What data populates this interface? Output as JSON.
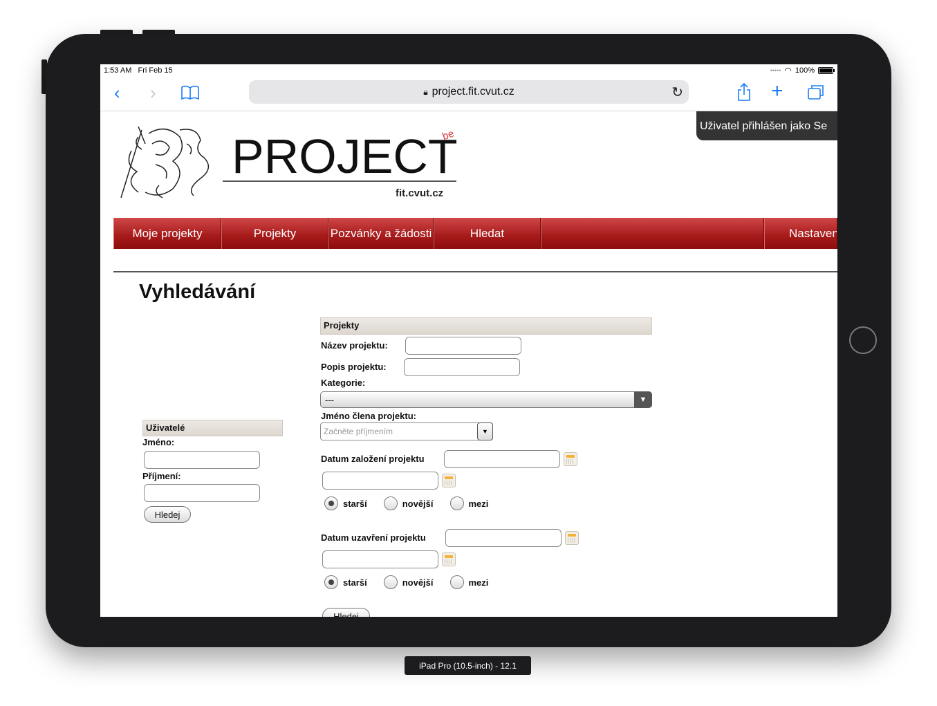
{
  "status_bar": {
    "time": "1:53 AM",
    "date": "Fri Feb 15",
    "battery": "100%",
    "battery_level": 1.0
  },
  "browser": {
    "url": "project.fit.cvut.cz"
  },
  "header": {
    "logo_word": "PROJECT",
    "logo_sub": "fit.cvut.cz",
    "logo_mark": "be",
    "user_status": "Uživatel přihlášen jako Se"
  },
  "nav": {
    "items": [
      "Moje projekty",
      "Projekty",
      "Pozvánky a žádosti",
      "Hledat",
      "",
      "Nastaven"
    ]
  },
  "page": {
    "title": "Vyhledávání"
  },
  "users": {
    "heading": "Uživatelé",
    "first_name_label": "Jméno:",
    "last_name_label": "Příjmení:",
    "search_button": "Hledej"
  },
  "projects": {
    "heading": "Projekty",
    "name_label": "Název projektu:",
    "description_label": "Popis projektu:",
    "category_label": "Kategorie:",
    "category_value": "---",
    "member_label": "Jméno člena projektu:",
    "member_placeholder": "Začněte příjmením",
    "founded_label": "Datum založení projektu",
    "closed_label": "Datum uzavření projektu",
    "radio_options": [
      "starší",
      "novější",
      "mezi"
    ],
    "search_button": "Hledej"
  },
  "device_label": "iPad Pro (10.5-inch) - 12.1",
  "colors": {
    "accent": "#1a7cf5",
    "nav_red": "#a81c1c",
    "section_bg": "#e4dfd8"
  }
}
